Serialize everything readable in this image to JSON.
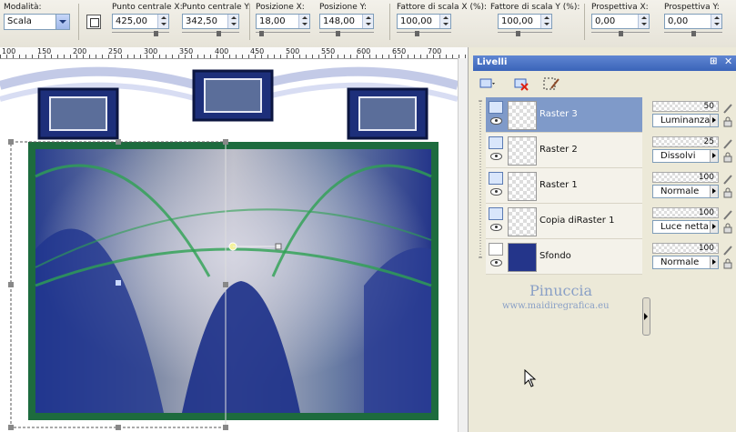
{
  "toolbar": {
    "mode_label": "Modalità:",
    "mode_value": "Scala",
    "fields": [
      {
        "label": "Punto centrale X:",
        "value": "425,00"
      },
      {
        "label": "Punto centrale Y:",
        "value": "342,50"
      },
      {
        "label": "Posizione X:",
        "value": "18,00"
      },
      {
        "label": "Posizione Y:",
        "value": "148,00"
      },
      {
        "label": "Fattore di scala X (%):",
        "value": "100,00"
      },
      {
        "label": "Fattore di scala Y (%):",
        "value": "100,00"
      },
      {
        "label": "Prospettiva X:",
        "value": "0,00"
      },
      {
        "label": "Prospettiva Y:",
        "value": "0,00"
      }
    ]
  },
  "ruler": {
    "ticks": [
      "100",
      "150",
      "200",
      "250",
      "300",
      "350",
      "400",
      "450",
      "500",
      "550",
      "600",
      "650",
      "700"
    ]
  },
  "layers_palette": {
    "title": "Livelli",
    "layers": [
      {
        "name": "Raster 3",
        "opacity": "50",
        "blend": "Luminanza",
        "selected": true
      },
      {
        "name": "Raster 2",
        "opacity": "25",
        "blend": "Dissolvi",
        "selected": false
      },
      {
        "name": "Raster 1",
        "opacity": "100",
        "blend": "Normale",
        "selected": false
      },
      {
        "name": "Copia diRaster 1",
        "opacity": "100",
        "blend": "Luce netta",
        "selected": false
      },
      {
        "name": "Sfondo",
        "opacity": "100",
        "blend": "Normale",
        "selected": false
      }
    ]
  },
  "watermark": {
    "name": "Pinuccia",
    "site": "www.maidiregrafica.eu"
  },
  "colors": {
    "accent": "#3b64b9",
    "selected_row": "#7f9ac9",
    "frame_green": "#1d6b3e",
    "image_blue": "#2a3f8f"
  }
}
